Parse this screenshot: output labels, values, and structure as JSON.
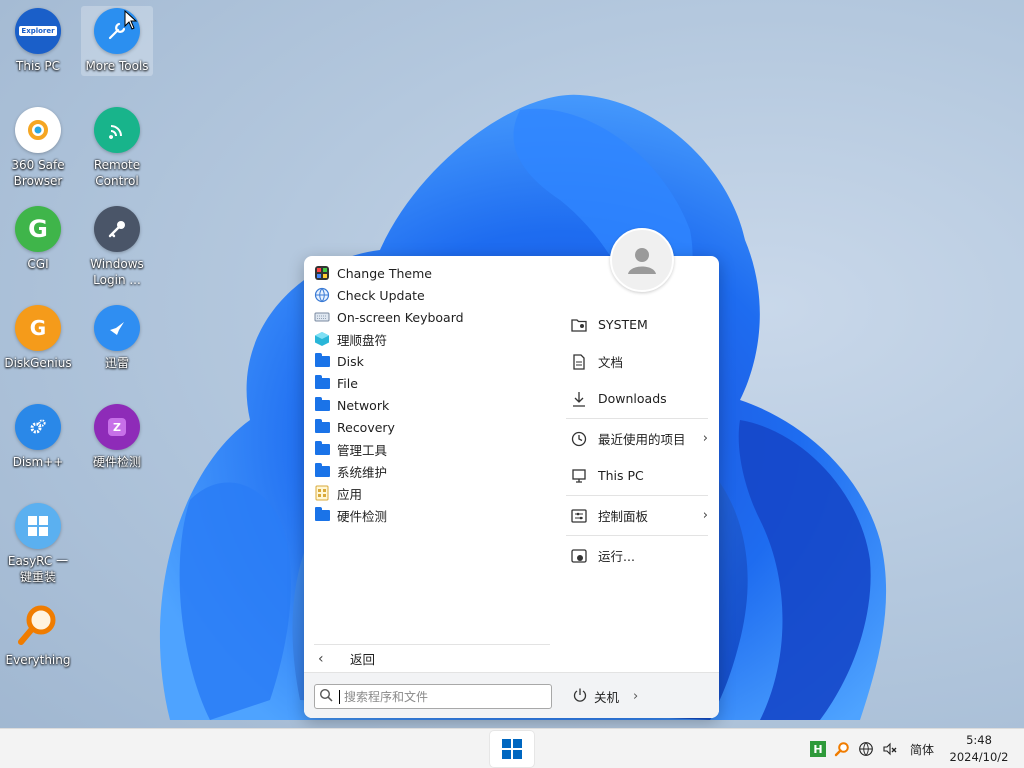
{
  "desktop": {
    "icons": [
      {
        "label": "This PC",
        "badge": "Explorer"
      },
      {
        "label": "More Tools"
      },
      {
        "label": "360 Safe Browser"
      },
      {
        "label": "Remote Control"
      },
      {
        "label": "CGI",
        "glyph": "G"
      },
      {
        "label": "Windows Login ..."
      },
      {
        "label": "DiskGenius",
        "glyph": "G"
      },
      {
        "label": "迅雷"
      },
      {
        "label": "Dism++"
      },
      {
        "label": "硬件检测",
        "glyph": "Z"
      },
      {
        "label": "EasyRC 一键重装"
      },
      {
        "label": "Everything"
      }
    ]
  },
  "start_menu": {
    "programs": [
      {
        "label": "Change Theme",
        "icon": "theme-icon"
      },
      {
        "label": "Check Update",
        "icon": "globe-icon"
      },
      {
        "label": "On-screen Keyboard",
        "icon": "keyboard-icon"
      },
      {
        "label": "理顺盘符",
        "icon": "cube-icon"
      },
      {
        "label": "Disk",
        "icon": "folder-icon"
      },
      {
        "label": "File",
        "icon": "folder-icon"
      },
      {
        "label": "Network",
        "icon": "folder-icon"
      },
      {
        "label": "Recovery",
        "icon": "folder-icon"
      },
      {
        "label": "管理工具",
        "icon": "folder-icon"
      },
      {
        "label": "系统维护",
        "icon": "folder-icon"
      },
      {
        "label": "应用",
        "icon": "app-icon"
      },
      {
        "label": "硬件检测",
        "icon": "folder-icon"
      }
    ],
    "back_label": "返回",
    "right_items": [
      {
        "label": "SYSTEM",
        "icon": "user-folder-icon"
      },
      {
        "label": "文档",
        "icon": "document-icon"
      },
      {
        "label": "Downloads",
        "icon": "download-icon"
      },
      {
        "label": "最近使用的项目",
        "icon": "clock-icon"
      },
      {
        "label": "This PC",
        "icon": "computer-icon"
      },
      {
        "label": "控制面板",
        "icon": "control-panel-icon"
      },
      {
        "label": "运行...",
        "icon": "run-icon"
      }
    ],
    "search": {
      "placeholder": "搜索程序和文件",
      "value": ""
    },
    "power_label": "关机"
  },
  "taskbar": {
    "tray_language": "简体",
    "clock_time": "5:48",
    "clock_date": "2024/10/2",
    "tray_badge": "H"
  },
  "colors": {
    "accent": "#0067c0",
    "folder": "#1a73e8",
    "menu_bg": "#ffffff",
    "footer_bg": "#f2f3f5"
  }
}
